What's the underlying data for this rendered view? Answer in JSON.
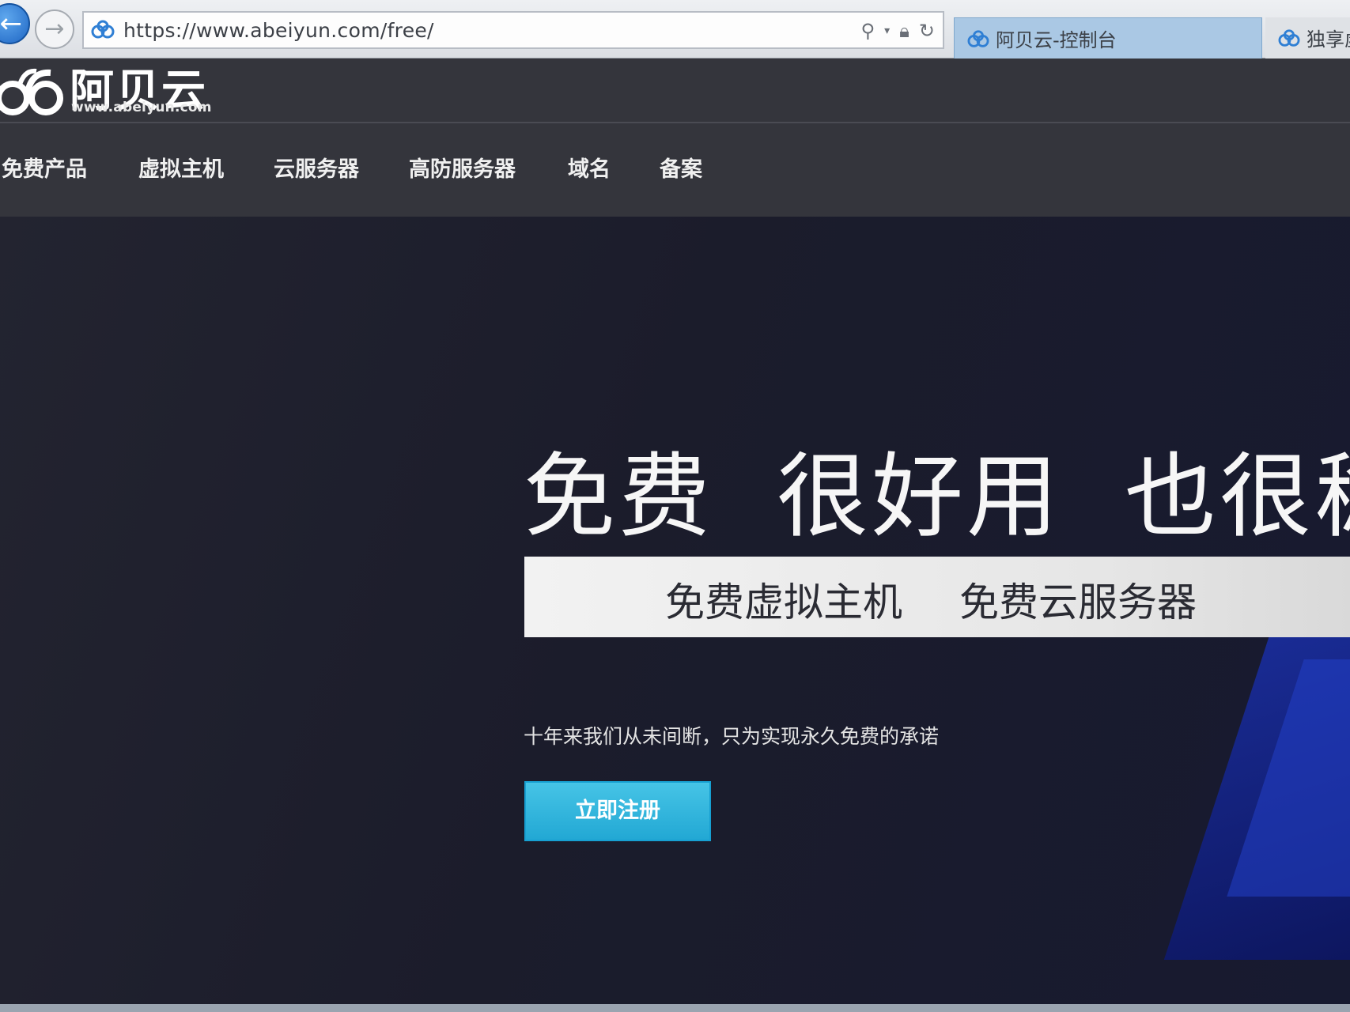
{
  "browser": {
    "url": "https://www.abeiyun.com/free/",
    "tabs": [
      {
        "label": "阿贝云-控制台"
      },
      {
        "label": "独享虚"
      }
    ]
  },
  "site": {
    "logo_text": "阿贝云",
    "logo_domain": "www.abeiyun.com",
    "nav": [
      {
        "label": "免费产品"
      },
      {
        "label": "虚拟主机"
      },
      {
        "label": "云服务器"
      },
      {
        "label": "高防服务器"
      },
      {
        "label": "域名"
      },
      {
        "label": "备案"
      }
    ]
  },
  "hero": {
    "headline": [
      "免费",
      "很好用",
      "也很稳定"
    ],
    "products": [
      "免费虚拟主机",
      "免费云服务器"
    ],
    "subtitle": "十年来我们从未间断，只为实现永久免费的承诺",
    "cta": "立即注册"
  },
  "colors": {
    "header_bg": "#34353c",
    "hero_bg": "#1c1d2a",
    "cta_bg": "#2bb3dd",
    "tab_active": "#aac8e4"
  },
  "icons": {
    "favicon": "abeiyun-cloud-icon",
    "back": "back-arrow-icon",
    "forward": "forward-arrow-icon",
    "search": "search-icon",
    "lock": "lock-icon",
    "refresh": "refresh-icon"
  }
}
